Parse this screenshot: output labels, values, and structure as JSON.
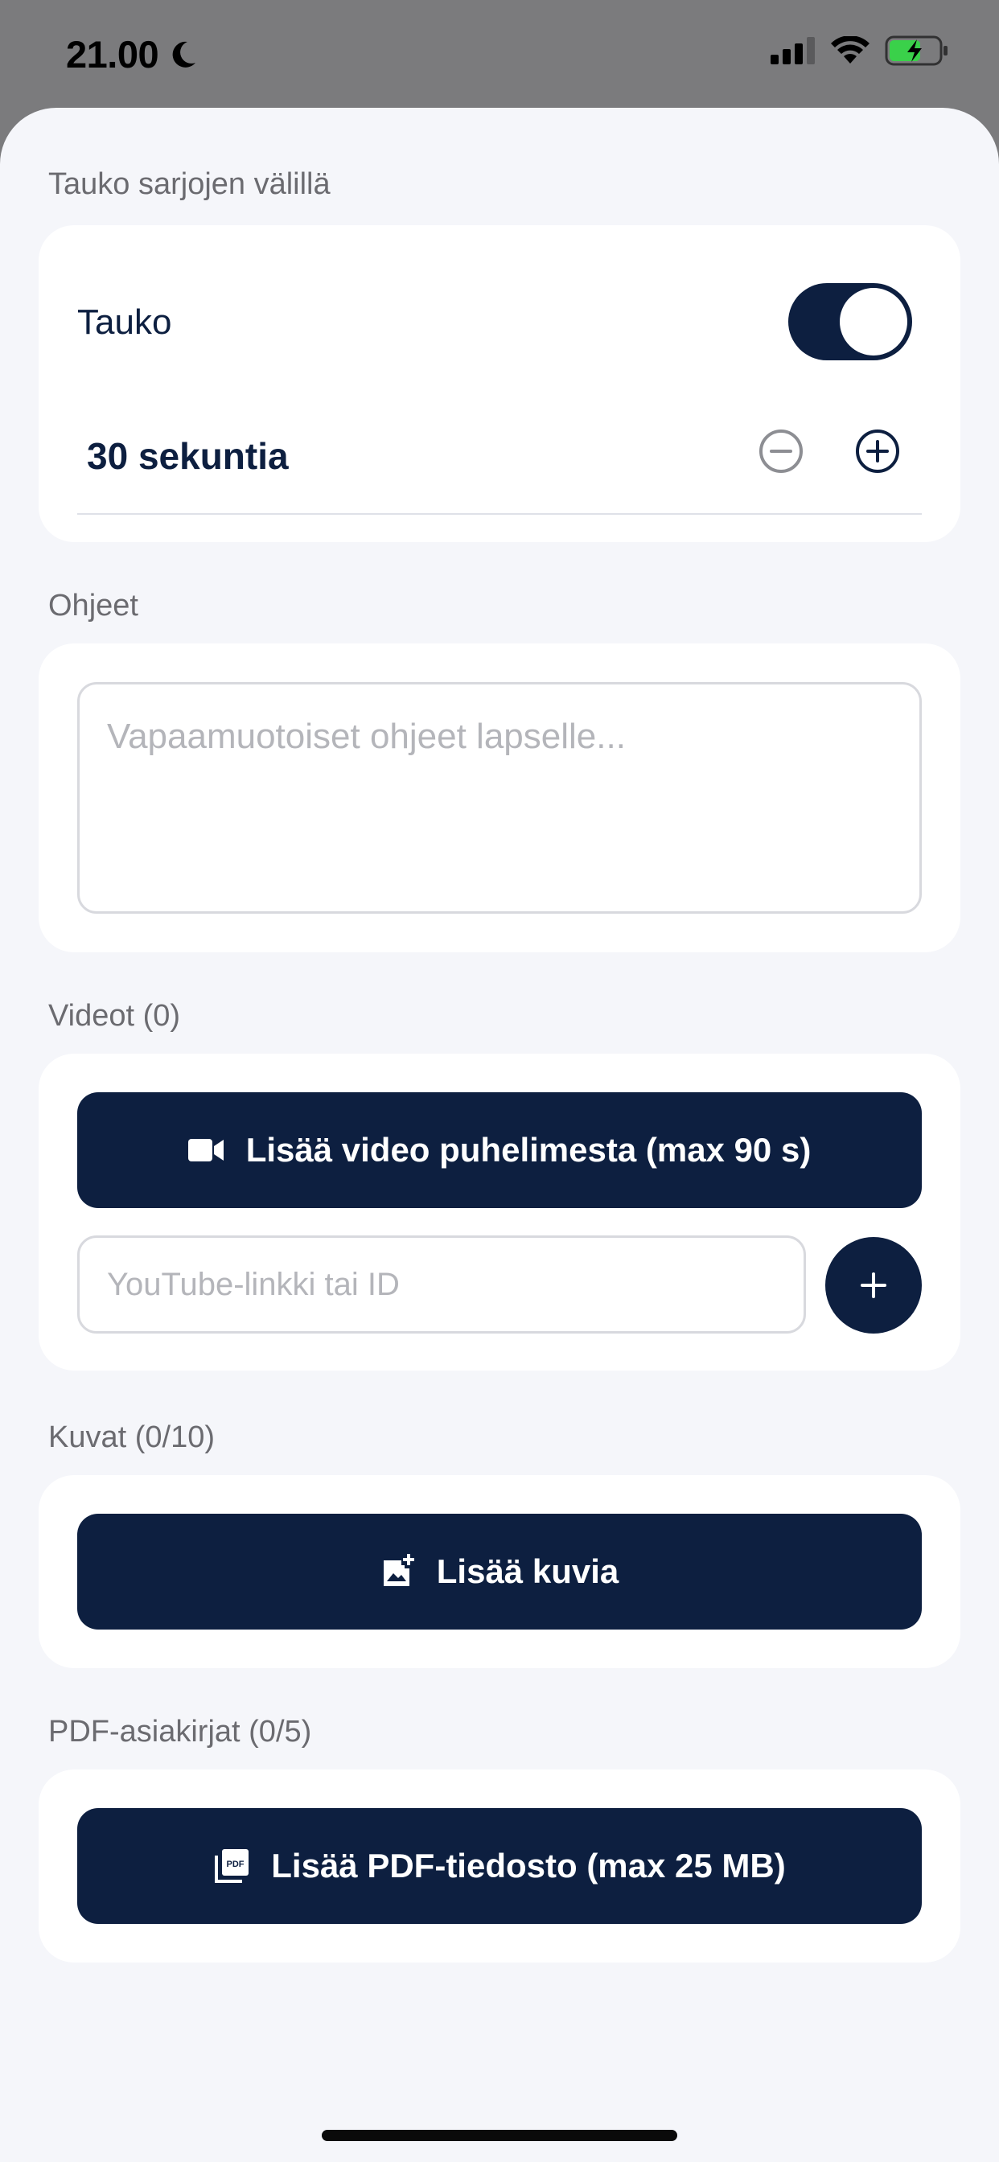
{
  "status_bar": {
    "time": "21.00"
  },
  "pause_section": {
    "heading": "Tauko sarjojen välillä",
    "toggle_label": "Tauko",
    "toggle_on": true,
    "duration": "30 sekuntia"
  },
  "instructions_section": {
    "heading": "Ohjeet",
    "placeholder": "Vapaamuotoiset ohjeet lapselle..."
  },
  "videos_section": {
    "heading": "Videot (0)",
    "add_video_label": "Lisää video puhelimesta (max 90 s)",
    "youtube_placeholder": "YouTube-linkki tai ID"
  },
  "images_section": {
    "heading": "Kuvat (0/10)",
    "add_images_label": "Lisää kuvia"
  },
  "pdf_section": {
    "heading": "PDF-asiakirjat (0/5)",
    "add_pdf_label": "Lisää PDF-tiedosto (max 25 MB)"
  },
  "colors": {
    "primary": "#0d1f40",
    "background": "#f5f6fa",
    "card": "#ffffff"
  }
}
